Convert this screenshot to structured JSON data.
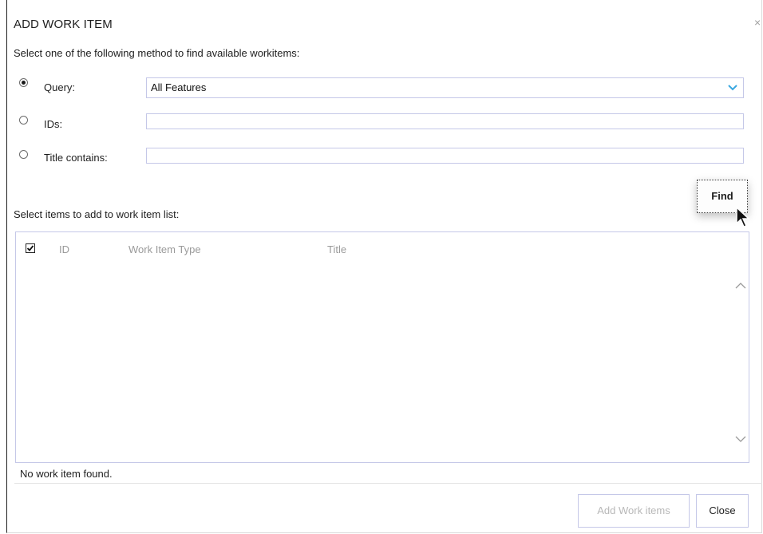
{
  "dialog": {
    "title": "ADD WORK ITEM",
    "close_glyph": "×",
    "instruction": "Select one of the following method to find available workitems:"
  },
  "methods": {
    "query_label": "Query:",
    "query_value": "All Features",
    "query_selected": true,
    "ids_label": "IDs:",
    "ids_value": "",
    "title_label": "Title contains:",
    "title_value": ""
  },
  "find_label": "Find",
  "list": {
    "caption": "Select items to add to work item list:",
    "columns": [
      "ID",
      "Work Item Type",
      "Title"
    ],
    "select_all_checked": true,
    "rows": []
  },
  "status_text": "No work item found.",
  "footer": {
    "add_label": "Add Work items",
    "close_label": "Close"
  },
  "colors": {
    "accent": "#39a7e0",
    "border": "#c5c8e8",
    "disabled_text": "#b8b8b8"
  },
  "icons": {
    "select_arrow": "chevron-down-icon",
    "scroll_up": "chevron-up-icon",
    "scroll_down": "chevron-down-icon",
    "checkbox": "check-icon",
    "cursor": "mouse-pointer-icon"
  }
}
